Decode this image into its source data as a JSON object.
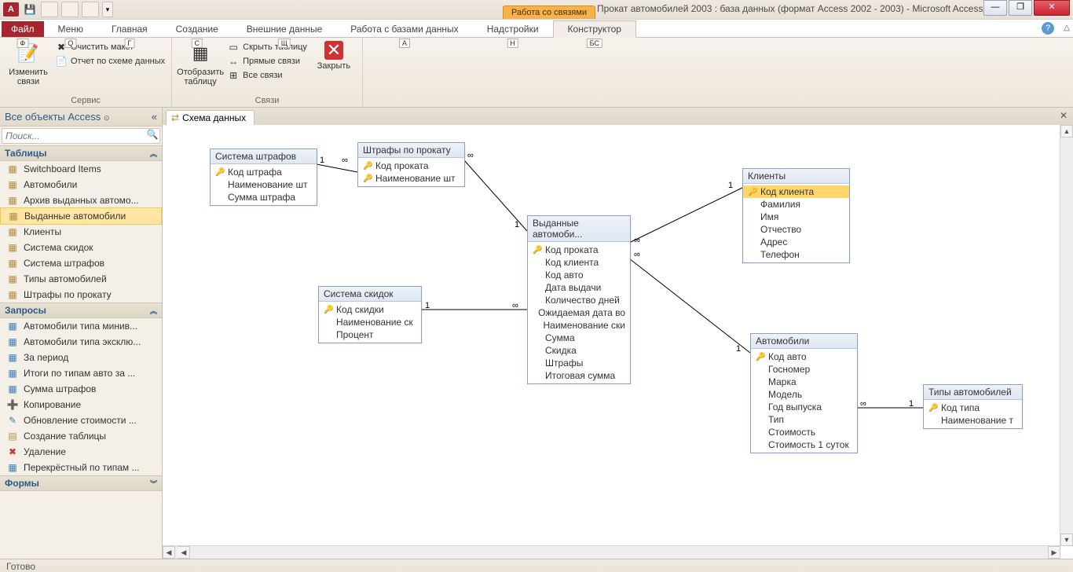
{
  "app": {
    "icon_letter": "A",
    "title": "Прокат автомобилей 2003 : база данных (формат Access 2002 - 2003)  -  Microsoft Access",
    "context_tab": "Работа со связями",
    "win_min": "—",
    "win_max": "❐",
    "win_close": "✕"
  },
  "qat": {
    "btns": [
      "1",
      "2",
      "3",
      "▾"
    ]
  },
  "tabs": {
    "file": "Файл",
    "file_kt": "Ф",
    "items": [
      {
        "label": "Меню",
        "kt": "Q"
      },
      {
        "label": "Главная",
        "kt": "Г"
      },
      {
        "label": "Создание",
        "kt": "С"
      },
      {
        "label": "Внешние данные",
        "kt": "Щ"
      },
      {
        "label": "Работа с базами данных",
        "kt": "А"
      },
      {
        "label": "Надстройки",
        "kt": "Н"
      },
      {
        "label": "Конструктор",
        "kt": "БС",
        "active": true
      }
    ],
    "help": "?",
    "collapse": "△"
  },
  "ribbon": {
    "g1": {
      "label": "Сервис",
      "edit_rel": "Изменить связи",
      "clear_layout": "Очистить макет",
      "rel_report": "Отчет по схеме данных"
    },
    "g2": {
      "label": "Связи",
      "show_table": "Отобразить таблицу",
      "hide_table": "Скрыть таблицу",
      "direct_rel": "Прямые связи",
      "all_rel": "Все связи",
      "close": "Закрыть"
    }
  },
  "nav": {
    "title": "Все объекты Access",
    "collapse": "«",
    "search_placeholder": "Поиск...",
    "groups": {
      "tables": {
        "title": "Таблицы",
        "chev": "︽"
      },
      "queries": {
        "title": "Запросы",
        "chev": "︽"
      },
      "forms": {
        "title": "Формы",
        "chev": "︾"
      }
    },
    "tables": [
      "Switchboard Items",
      "Автомобили",
      "Архив выданных автомо...",
      "Выданные автомобили",
      "Клиенты",
      "Система скидок",
      "Система штрафов",
      "Типы автомобилей",
      "Штрафы по прокату"
    ],
    "selected_table_index": 3,
    "queries": [
      {
        "t": "sel",
        "l": "Автомобили типа минив..."
      },
      {
        "t": "sel",
        "l": "Автомобили типа эксклю..."
      },
      {
        "t": "sel",
        "l": "За период"
      },
      {
        "t": "sel",
        "l": "Итоги по типам авто за ..."
      },
      {
        "t": "sel",
        "l": "Сумма штрафов"
      },
      {
        "t": "app",
        "l": "Копирование"
      },
      {
        "t": "upd",
        "l": "Обновление стоимости ..."
      },
      {
        "t": "mk",
        "l": "Создание таблицы"
      },
      {
        "t": "del",
        "l": "Удаление"
      },
      {
        "t": "xt",
        "l": "Перекрёстный по типам ..."
      }
    ]
  },
  "doc": {
    "tab_label": "Схема данных",
    "close": "✕"
  },
  "boxes": {
    "sys_fines": {
      "title": "Система штрафов",
      "fields": [
        {
          "k": true,
          "n": "Код штрафа"
        },
        {
          "k": false,
          "n": "Наименование шт"
        },
        {
          "k": false,
          "n": "Сумма штрафа"
        }
      ]
    },
    "fines_rent": {
      "title": "Штрафы по прокату",
      "fields": [
        {
          "k": true,
          "n": "Код проката"
        },
        {
          "k": true,
          "n": "Наименование шт"
        }
      ]
    },
    "clients": {
      "title": "Клиенты",
      "fields": [
        {
          "k": true,
          "n": "Код клиента",
          "sel": true
        },
        {
          "k": false,
          "n": "Фамилия"
        },
        {
          "k": false,
          "n": "Имя"
        },
        {
          "k": false,
          "n": "Отчество"
        },
        {
          "k": false,
          "n": "Адрес"
        },
        {
          "k": false,
          "n": "Телефон"
        }
      ]
    },
    "issued": {
      "title": "Выданные автомоби...",
      "fields": [
        {
          "k": true,
          "n": "Код проката"
        },
        {
          "k": false,
          "n": "Код клиента"
        },
        {
          "k": false,
          "n": "Код авто"
        },
        {
          "k": false,
          "n": "Дата выдачи"
        },
        {
          "k": false,
          "n": "Количество дней"
        },
        {
          "k": false,
          "n": "Ожидаемая дата во"
        },
        {
          "k": false,
          "n": "Наименование ски"
        },
        {
          "k": false,
          "n": "Сумма"
        },
        {
          "k": false,
          "n": "Скидка"
        },
        {
          "k": false,
          "n": "Штрафы"
        },
        {
          "k": false,
          "n": "Итоговая сумма"
        }
      ]
    },
    "discounts": {
      "title": "Система скидок",
      "fields": [
        {
          "k": true,
          "n": "Код скидки"
        },
        {
          "k": false,
          "n": "Наименование ск"
        },
        {
          "k": false,
          "n": "Процент"
        }
      ]
    },
    "cars": {
      "title": "Автомобили",
      "fields": [
        {
          "k": true,
          "n": "Код авто"
        },
        {
          "k": false,
          "n": "Госномер"
        },
        {
          "k": false,
          "n": "Марка"
        },
        {
          "k": false,
          "n": "Модель"
        },
        {
          "k": false,
          "n": "Год выпуска"
        },
        {
          "k": false,
          "n": "Тип"
        },
        {
          "k": false,
          "n": "Стоимость"
        },
        {
          "k": false,
          "n": "Стоимость 1 суток"
        }
      ]
    },
    "cartypes": {
      "title": "Типы автомобилей",
      "fields": [
        {
          "k": true,
          "n": "Код типа"
        },
        {
          "k": false,
          "n": "Наименование т"
        }
      ]
    }
  },
  "status": "Готово"
}
